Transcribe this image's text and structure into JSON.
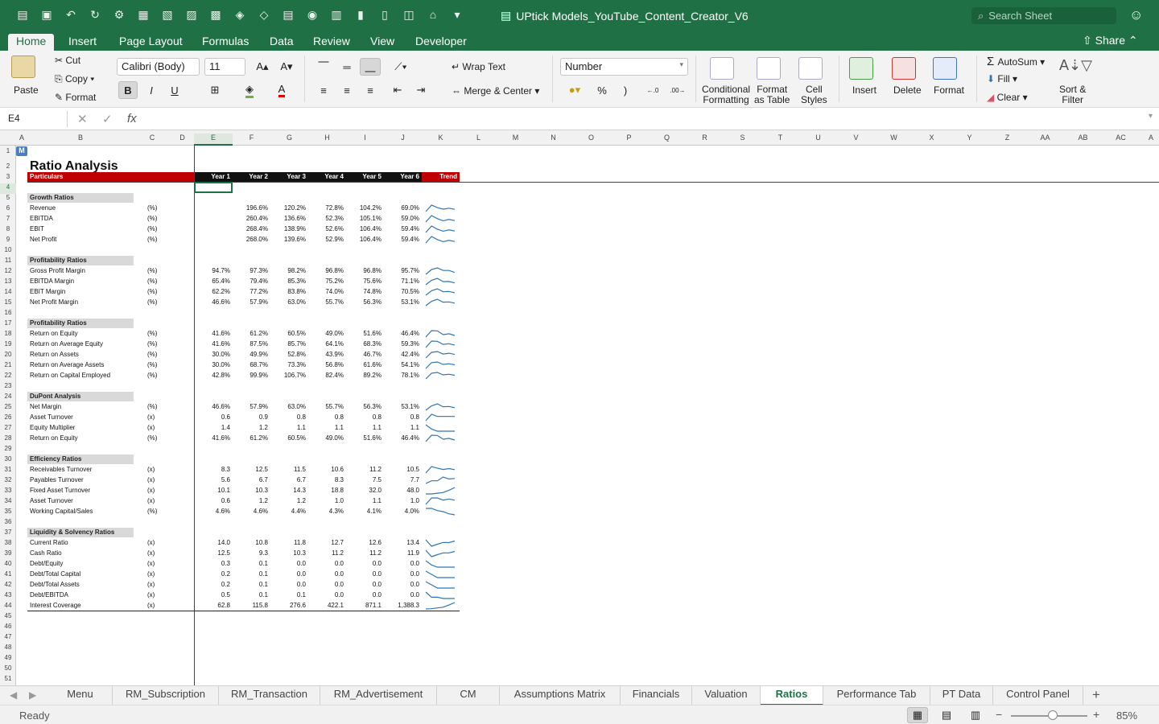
{
  "window": {
    "title": "UPtick Models_YouTube_Content_Creator_V6",
    "search_placeholder": "Search Sheet"
  },
  "ribbon_tabs": [
    "Home",
    "Insert",
    "Page Layout",
    "Formulas",
    "Data",
    "Review",
    "View",
    "Developer"
  ],
  "share_label": "Share",
  "ribbon": {
    "paste": "Paste",
    "cut": "Cut",
    "copy": "Copy",
    "format": "Format",
    "font_name": "Calibri (Body)",
    "font_size": "11",
    "bold": "B",
    "italic": "I",
    "underline": "U",
    "wrap_text": "Wrap Text",
    "merge_center": "Merge & Center",
    "number_format": "Number",
    "percent": "%",
    "comma": ")",
    "conditional_formatting": "Conditional\nFormatting",
    "format_as_table": "Format\nas Table",
    "cell_styles": "Cell\nStyles",
    "insert": "Insert",
    "delete": "Delete",
    "format_cells": "Format",
    "autosum": "AutoSum",
    "fill": "Fill",
    "clear": "Clear",
    "sort_filter": "Sort &\nFilter"
  },
  "formula_bar": {
    "name_box": "E4",
    "fx": "fx",
    "formula": ""
  },
  "columns": [
    "A",
    "B",
    "C",
    "D",
    "E",
    "F",
    "G",
    "H",
    "I",
    "J",
    "K",
    "L",
    "M",
    "N",
    "O",
    "P",
    "Q",
    "R",
    "S",
    "T",
    "U",
    "V",
    "W",
    "X",
    "Y",
    "Z",
    "AA",
    "AB",
    "AC",
    "A"
  ],
  "sheet": {
    "title": "Ratio Analysis",
    "header": {
      "particulars": "Particulars",
      "years": [
        "Year 1",
        "Year 2",
        "Year 3",
        "Year 4",
        "Year 5",
        "Year 6"
      ],
      "trend": "Trend"
    },
    "sections": [
      {
        "name": "Growth Ratios",
        "row": 5,
        "items": [
          {
            "row": 6,
            "label": "Revenue",
            "unit": "(%)",
            "values": [
              "",
              "196.6%",
              "120.2%",
              "72.8%",
              "104.2%",
              "69.0%"
            ],
            "trend": [
              0,
              196.6,
              120.2,
              72.8,
              104.2,
              69.0
            ]
          },
          {
            "row": 7,
            "label": "EBITDA",
            "unit": "(%)",
            "values": [
              "",
              "260.4%",
              "136.6%",
              "52.3%",
              "105.1%",
              "59.0%"
            ],
            "trend": [
              0,
              260.4,
              136.6,
              52.3,
              105.1,
              59.0
            ]
          },
          {
            "row": 8,
            "label": "EBIT",
            "unit": "(%)",
            "values": [
              "",
              "268.4%",
              "138.9%",
              "52.6%",
              "106.4%",
              "59.4%"
            ],
            "trend": [
              0,
              268.4,
              138.9,
              52.6,
              106.4,
              59.4
            ]
          },
          {
            "row": 9,
            "label": "Net Profit",
            "unit": "(%)",
            "values": [
              "",
              "268.0%",
              "139.6%",
              "52.9%",
              "106.4%",
              "59.4%"
            ],
            "trend": [
              0,
              268.0,
              139.6,
              52.9,
              106.4,
              59.4
            ]
          }
        ]
      },
      {
        "name": "Profitability Ratios",
        "row": 11,
        "items": [
          {
            "row": 12,
            "label": "Gross Profit Margin",
            "unit": "(%)",
            "values": [
              "94.7%",
              "97.3%",
              "98.2%",
              "96.8%",
              "96.8%",
              "95.7%"
            ],
            "trend": [
              94.7,
              97.3,
              98.2,
              96.8,
              96.8,
              95.7
            ]
          },
          {
            "row": 13,
            "label": "EBITDA Margin",
            "unit": "(%)",
            "values": [
              "65.4%",
              "79.4%",
              "85.3%",
              "75.2%",
              "75.6%",
              "71.1%"
            ],
            "trend": [
              65.4,
              79.4,
              85.3,
              75.2,
              75.6,
              71.1
            ]
          },
          {
            "row": 14,
            "label": "EBIT Margin",
            "unit": "(%)",
            "values": [
              "62.2%",
              "77.2%",
              "83.8%",
              "74.0%",
              "74.8%",
              "70.5%"
            ],
            "trend": [
              62.2,
              77.2,
              83.8,
              74.0,
              74.8,
              70.5
            ]
          },
          {
            "row": 15,
            "label": "Net Profit Margin",
            "unit": "(%)",
            "values": [
              "46.6%",
              "57.9%",
              "63.0%",
              "55.7%",
              "56.3%",
              "53.1%"
            ],
            "trend": [
              46.6,
              57.9,
              63.0,
              55.7,
              56.3,
              53.1
            ]
          }
        ]
      },
      {
        "name": "Profitability Ratios",
        "row": 17,
        "items": [
          {
            "row": 18,
            "label": "Return on Equity",
            "unit": "(%)",
            "values": [
              "41.6%",
              "61.2%",
              "60.5%",
              "49.0%",
              "51.6%",
              "46.4%"
            ],
            "trend": [
              41.6,
              61.2,
              60.5,
              49.0,
              51.6,
              46.4
            ]
          },
          {
            "row": 19,
            "label": "Return on Average Equity",
            "unit": "(%)",
            "values": [
              "41.6%",
              "87.5%",
              "85.7%",
              "64.1%",
              "68.3%",
              "59.3%"
            ],
            "trend": [
              41.6,
              87.5,
              85.7,
              64.1,
              68.3,
              59.3
            ]
          },
          {
            "row": 20,
            "label": "Return on Assets",
            "unit": "(%)",
            "values": [
              "30.0%",
              "49.9%",
              "52.8%",
              "43.9%",
              "46.7%",
              "42.4%"
            ],
            "trend": [
              30.0,
              49.9,
              52.8,
              43.9,
              46.7,
              42.4
            ]
          },
          {
            "row": 21,
            "label": "Return on Average Assets",
            "unit": "(%)",
            "values": [
              "30.0%",
              "68.7%",
              "73.3%",
              "56.8%",
              "61.6%",
              "54.1%"
            ],
            "trend": [
              30.0,
              68.7,
              73.3,
              56.8,
              61.6,
              54.1
            ]
          },
          {
            "row": 22,
            "label": "Return on Capital Employed",
            "unit": "(%)",
            "values": [
              "42.8%",
              "99.9%",
              "106.7%",
              "82.4%",
              "89.2%",
              "78.1%"
            ],
            "trend": [
              42.8,
              99.9,
              106.7,
              82.4,
              89.2,
              78.1
            ]
          }
        ]
      },
      {
        "name": "DuPont Analysis",
        "row": 24,
        "items": [
          {
            "row": 25,
            "label": "Net Margin",
            "unit": "(%)",
            "values": [
              "46.6%",
              "57.9%",
              "63.0%",
              "55.7%",
              "56.3%",
              "53.1%"
            ],
            "trend": [
              46.6,
              57.9,
              63.0,
              55.7,
              56.3,
              53.1
            ]
          },
          {
            "row": 26,
            "label": "Asset Turnover",
            "unit": "(x)",
            "values": [
              "0.6",
              "0.9",
              "0.8",
              "0.8",
              "0.8",
              "0.8"
            ],
            "trend": [
              0.6,
              0.9,
              0.8,
              0.8,
              0.8,
              0.8
            ]
          },
          {
            "row": 27,
            "label": "Equity Multiplier",
            "unit": "(x)",
            "values": [
              "1.4",
              "1.2",
              "1.1",
              "1.1",
              "1.1",
              "1.1"
            ],
            "trend": [
              1.4,
              1.2,
              1.1,
              1.1,
              1.1,
              1.1
            ]
          },
          {
            "row": 28,
            "label": "Return on Equity",
            "unit": "(%)",
            "values": [
              "41.6%",
              "61.2%",
              "60.5%",
              "49.0%",
              "51.6%",
              "46.4%"
            ],
            "trend": [
              41.6,
              61.2,
              60.5,
              49.0,
              51.6,
              46.4
            ]
          }
        ]
      },
      {
        "name": "Efficiency Ratios",
        "row": 30,
        "items": [
          {
            "row": 31,
            "label": "Receivables Turnover",
            "unit": "(x)",
            "values": [
              "8.3",
              "12.5",
              "11.5",
              "10.6",
              "11.2",
              "10.5"
            ],
            "trend": [
              8.3,
              12.5,
              11.5,
              10.6,
              11.2,
              10.5
            ]
          },
          {
            "row": 32,
            "label": "Payables Turnover",
            "unit": "(x)",
            "values": [
              "5.6",
              "6.7",
              "6.7",
              "8.3",
              "7.5",
              "7.7"
            ],
            "trend": [
              5.6,
              6.7,
              6.7,
              8.3,
              7.5,
              7.7
            ]
          },
          {
            "row": 33,
            "label": "Fixed Asset Turnover",
            "unit": "(x)",
            "values": [
              "10.1",
              "10.3",
              "14.3",
              "18.8",
              "32.0",
              "48.0"
            ],
            "trend": [
              10.1,
              10.3,
              14.3,
              18.8,
              32.0,
              48.0
            ]
          },
          {
            "row": 34,
            "label": "Asset Turnover",
            "unit": "(x)",
            "values": [
              "0.6",
              "1.2",
              "1.2",
              "1.0",
              "1.1",
              "1.0"
            ],
            "trend": [
              0.6,
              1.2,
              1.2,
              1.0,
              1.1,
              1.0
            ]
          },
          {
            "row": 35,
            "label": "Working Capital/Sales",
            "unit": "(%)",
            "values": [
              "4.6%",
              "4.6%",
              "4.4%",
              "4.3%",
              "4.1%",
              "4.0%"
            ],
            "trend": [
              4.6,
              4.6,
              4.4,
              4.3,
              4.1,
              4.0
            ]
          }
        ]
      },
      {
        "name": "Liquidity & Solvency Ratios",
        "row": 37,
        "items": [
          {
            "row": 38,
            "label": "Current Ratio",
            "unit": "(x)",
            "values": [
              "14.0",
              "10.8",
              "11.8",
              "12.7",
              "12.6",
              "13.4"
            ],
            "trend": [
              14.0,
              10.8,
              11.8,
              12.7,
              12.6,
              13.4
            ]
          },
          {
            "row": 39,
            "label": "Cash Ratio",
            "unit": "(x)",
            "values": [
              "12.5",
              "9.3",
              "10.3",
              "11.2",
              "11.2",
              "11.9"
            ],
            "trend": [
              12.5,
              9.3,
              10.3,
              11.2,
              11.2,
              11.9
            ]
          },
          {
            "row": 40,
            "label": "Debt/Equity",
            "unit": "(x)",
            "values": [
              "0.3",
              "0.1",
              "0.0",
              "0.0",
              "0.0",
              "0.0"
            ],
            "trend": [
              0.3,
              0.1,
              0.0,
              0.0,
              0.0,
              0.0
            ]
          },
          {
            "row": 41,
            "label": "Debt/Total Capital",
            "unit": "(x)",
            "values": [
              "0.2",
              "0.1",
              "0.0",
              "0.0",
              "0.0",
              "0.0"
            ],
            "trend": [
              0.2,
              0.1,
              0.0,
              0.0,
              0.0,
              0.0
            ]
          },
          {
            "row": 42,
            "label": "Debt/Total Assets",
            "unit": "(x)",
            "values": [
              "0.2",
              "0.1",
              "0.0",
              "0.0",
              "0.0",
              "0.0"
            ],
            "trend": [
              0.2,
              0.1,
              0.0,
              0.0,
              0.0,
              0.0
            ]
          },
          {
            "row": 43,
            "label": "Debt/EBITDA",
            "unit": "(x)",
            "values": [
              "0.5",
              "0.1",
              "0.1",
              "0.0",
              "0.0",
              "0.0"
            ],
            "trend": [
              0.5,
              0.1,
              0.1,
              0.0,
              0.0,
              0.0
            ]
          },
          {
            "row": 44,
            "label": "Interest Coverage",
            "unit": "(x)",
            "values": [
              "62.8",
              "115.8",
              "276.6",
              "422.1",
              "871.1",
              "1,388.3"
            ],
            "trend": [
              62.8,
              115.8,
              276.6,
              422.1,
              871.1,
              1388.3
            ]
          }
        ]
      }
    ]
  },
  "sheet_tabs": [
    "Menu",
    "RM_Subscription",
    "RM_Transaction",
    "RM_Advertisement",
    "CM",
    "Assumptions Matrix",
    "Financials",
    "Valuation",
    "Ratios",
    "Performance Tab",
    "PT Data",
    "Control Panel"
  ],
  "active_sheet": "Ratios",
  "status": {
    "text": "Ready",
    "zoom": "85%"
  },
  "colors": {
    "excel_green": "#1f7145",
    "header_red": "#c00000",
    "header_dark": "#111111",
    "sparkline": "#2f75b6"
  }
}
